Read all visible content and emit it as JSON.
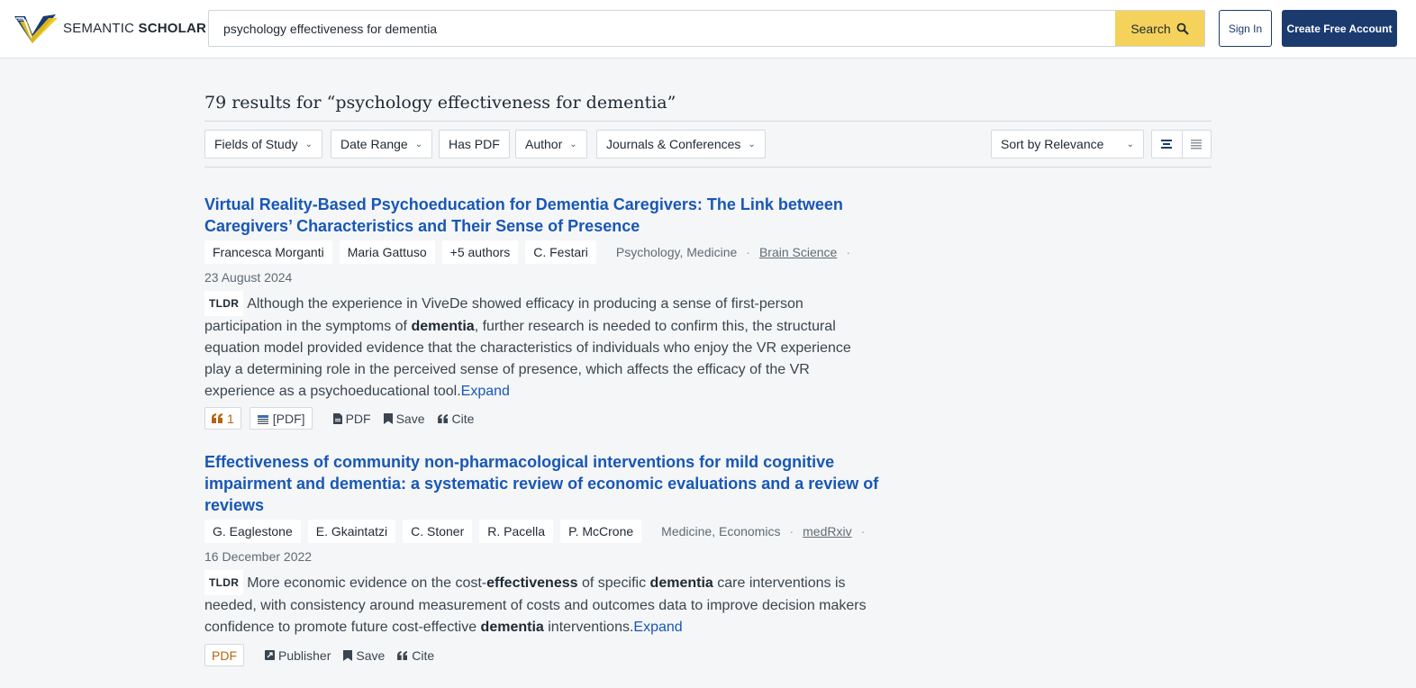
{
  "header": {
    "logo_text_light": "SEMANTIC",
    "logo_text_bold": "SCHOLAR",
    "search_value": "psychology effectiveness for dementia",
    "search_button": "Search",
    "sign_in": "Sign In",
    "create_account": "Create Free Account"
  },
  "results": {
    "title": "79 results for “psychology effectiveness for dementia”"
  },
  "filters": [
    {
      "label": "Fields of Study"
    },
    {
      "label": "Date Range"
    },
    {
      "label": "Has PDF"
    },
    {
      "label": "Author"
    },
    {
      "label": "Journals & Conferences"
    }
  ],
  "sort": {
    "label": "Sort by Relevance"
  },
  "papers": [
    {
      "title_line1": "Virtual Reality-Based Psychoeducation for Dementia Caregivers: The Link between",
      "title_line2": "Caregivers’ Characteristics and Their Sense of Presence",
      "authors": [
        "Francesca Morganti",
        "Maria Gattuso",
        "+5 authors",
        "C. Festari"
      ],
      "fields": "Psychology, Medicine",
      "venue": "Brain Science",
      "date": "23 August 2024",
      "tldr_label": "TLDR",
      "tldr_1": "Although the experience in ViveDe showed efficacy in producing a sense of first-person participation in the symptoms of ",
      "tldr_b1": "dementia",
      "tldr_2": ", further research is needed to confirm this, the structural equation model provided evidence that the characteristics of individuals who enjoy the VR experience play a determining role in the perceived sense of presence, which affects the efficacy of the VR experience as a psychoeducational tool.",
      "expand": "Expand",
      "citations": "1",
      "pdf_badge": "[PDF]",
      "action_pdf": "PDF",
      "action_save": "Save",
      "action_cite": "Cite"
    },
    {
      "title_line1": "Effectiveness of community non-pharmacological interventions for mild cognitive",
      "title_line2": "impairment and dementia: a systematic review of economic evaluations and a review of",
      "title_line3": "reviews",
      "authors": [
        "G. Eaglestone",
        "E. Gkaintatzi",
        "C. Stoner",
        "R. Pacella",
        "P. McCrone"
      ],
      "fields": "Medicine, Economics",
      "venue": "medRxiv",
      "date": "16 December 2022",
      "tldr_label": "TLDR",
      "tldr_1": "More economic evidence on the cost-",
      "tldr_b1": "effectiveness",
      "tldr_2": " of specific ",
      "tldr_b2": "dementia",
      "tldr_3": " care interventions is needed, with consistency around measurement of costs and outcomes data to improve decision makers confidence to promote future cost-effective ",
      "tldr_b3": "dementia",
      "tldr_4": " interventions.",
      "expand": "Expand",
      "pdf_badge": "PDF",
      "action_publisher": "Publisher",
      "action_save": "Save",
      "action_cite": "Cite"
    }
  ],
  "colors": {
    "brand_navy": "#1b3b6f",
    "search_yellow": "#f5d25b",
    "link_blue": "#1857b6",
    "badge_orange": "#b5650f"
  }
}
